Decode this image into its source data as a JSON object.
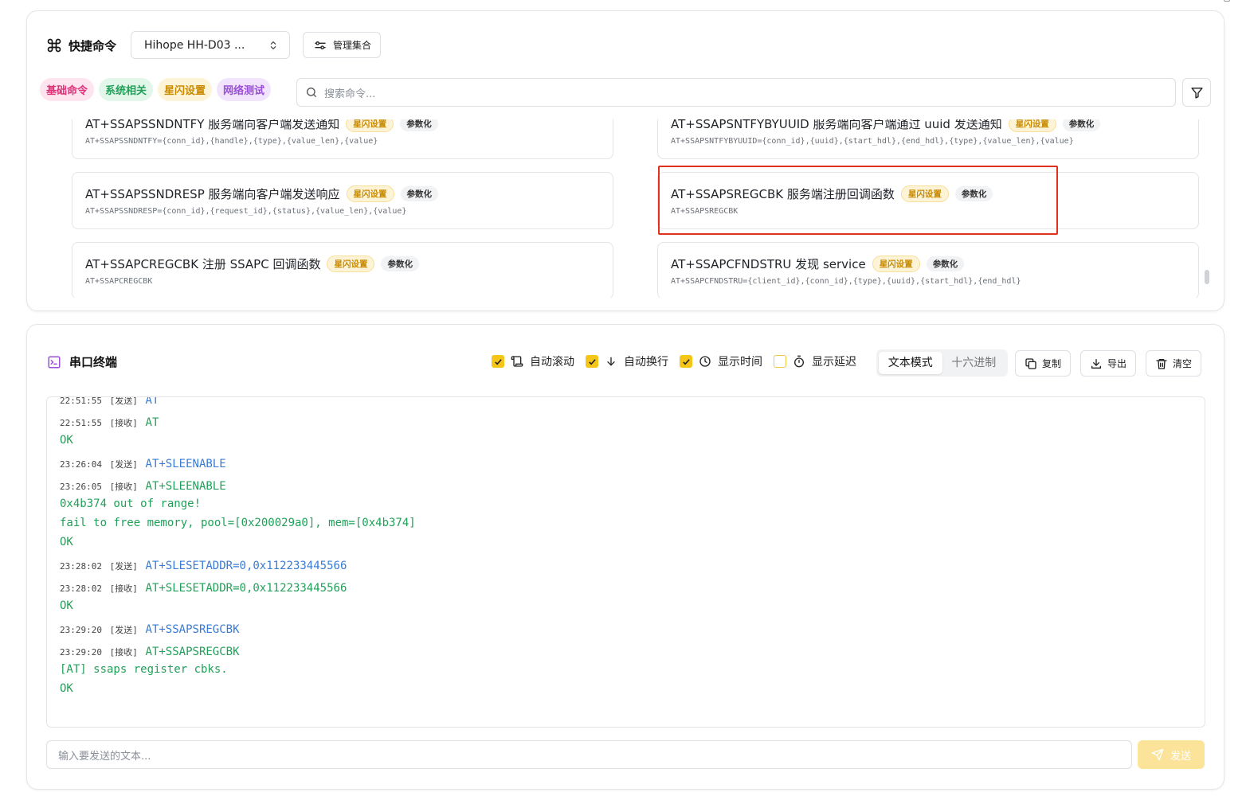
{
  "commands_panel": {
    "title": "快捷命令",
    "device_select": "Hihope HH-D03 ...",
    "manage_button": "管理集合",
    "categories": [
      {
        "label": "基础命令",
        "color": "#e0307a",
        "bg": "#fde4ee"
      },
      {
        "label": "系统相关",
        "color": "#22a05a",
        "bg": "#e2f6e9"
      },
      {
        "label": "星闪设置",
        "color": "#c88a00",
        "bg": "#fdf3d6"
      },
      {
        "label": "网络测试",
        "color": "#9b4fd8",
        "bg": "#f1e4fc"
      }
    ],
    "search_placeholder": "搜索命令...",
    "cards": [
      {
        "title": "AT+SSAPSSNDNTFY 服务端向客户端发送通知",
        "tag": "星闪设置",
        "param_tag": "参数化",
        "syntax": "AT+SSAPSSNDNTFY={conn_id},{handle},{type},{value_len},{value}"
      },
      {
        "title": "AT+SSAPSNTFYBYUUID 服务端向客户端通过 uuid 发送通知",
        "tag": "星闪设置",
        "param_tag": "参数化",
        "syntax": "AT+SSAPSNTFYBYUUID={conn_id},{uuid},{start_hdl},{end_hdl},{type},{value_len},{value}"
      },
      {
        "title": "AT+SSAPSSNDRESP 服务端向客户端发送响应",
        "tag": "星闪设置",
        "param_tag": "参数化",
        "syntax": "AT+SSAPSSNDRESP={conn_id},{request_id},{status},{value_len},{value}"
      },
      {
        "title": "AT+SSAPSREGCBK 服务端注册回调函数",
        "tag": "星闪设置",
        "param_tag": "参数化",
        "syntax": "AT+SSAPSREGCBK"
      },
      {
        "title": "AT+SSAPCREGCBK 注册 SSAPC 回调函数",
        "tag": "星闪设置",
        "param_tag": "参数化",
        "syntax": "AT+SSAPCREGCBK"
      },
      {
        "title": "AT+SSAPCFNDSTRU 发现 service",
        "tag": "星闪设置",
        "param_tag": "参数化",
        "syntax": "AT+SSAPCFNDSTRU={client_id},{conn_id},{type},{uuid},{start_hdl},{end_hdl}"
      }
    ]
  },
  "terminal": {
    "title": "串口终端",
    "options": [
      {
        "label": "自动滚动",
        "checked": true,
        "icon": "scroll-icon"
      },
      {
        "label": "自动换行",
        "checked": true,
        "icon": "arrow-down-icon"
      },
      {
        "label": "显示时间",
        "checked": true,
        "icon": "clock-icon"
      },
      {
        "label": "显示延迟",
        "checked": false,
        "icon": "timer-icon"
      }
    ],
    "modes": [
      "文本模式",
      "十六进制"
    ],
    "active_mode": "文本模式",
    "copy_button": "复制",
    "export_button": "导出",
    "clear_button": "清空",
    "log": [
      {
        "time": "22:51:55",
        "dir": "[发送]",
        "text": "AT",
        "kind": "send"
      },
      {
        "time": "22:51:55",
        "dir": "[接收]",
        "text": "AT",
        "kind": "recv"
      },
      {
        "text": "OK",
        "kind": "recv-cont"
      },
      {
        "time": "23:26:04",
        "dir": "[发送]",
        "text": "AT+SLEENABLE",
        "kind": "send"
      },
      {
        "time": "23:26:05",
        "dir": "[接收]",
        "text": "AT+SLEENABLE",
        "kind": "recv"
      },
      {
        "text": "0x4b374 out of range!",
        "kind": "recv-cont"
      },
      {
        "text": "fail to free memory, pool=[0x200029a0], mem=[0x4b374]",
        "kind": "recv-cont"
      },
      {
        "text": "OK",
        "kind": "recv-cont"
      },
      {
        "time": "23:28:02",
        "dir": "[发送]",
        "text": "AT+SLESETADDR=0,0x112233445566",
        "kind": "send"
      },
      {
        "time": "23:28:02",
        "dir": "[接收]",
        "text": "AT+SLESETADDR=0,0x112233445566",
        "kind": "recv"
      },
      {
        "text": "OK",
        "kind": "recv-cont"
      },
      {
        "time": "23:29:20",
        "dir": "[发送]",
        "text": "AT+SSAPSREGCBK",
        "kind": "send"
      },
      {
        "time": "23:29:20",
        "dir": "[接收]",
        "text": "AT+SSAPSREGCBK",
        "kind": "recv"
      },
      {
        "text": "[AT] ssaps register cbks.",
        "kind": "recv-cont"
      },
      {
        "text": "OK",
        "kind": "recv-cont"
      }
    ],
    "input_placeholder": "输入要发送的文本...",
    "send_button": "发送"
  }
}
